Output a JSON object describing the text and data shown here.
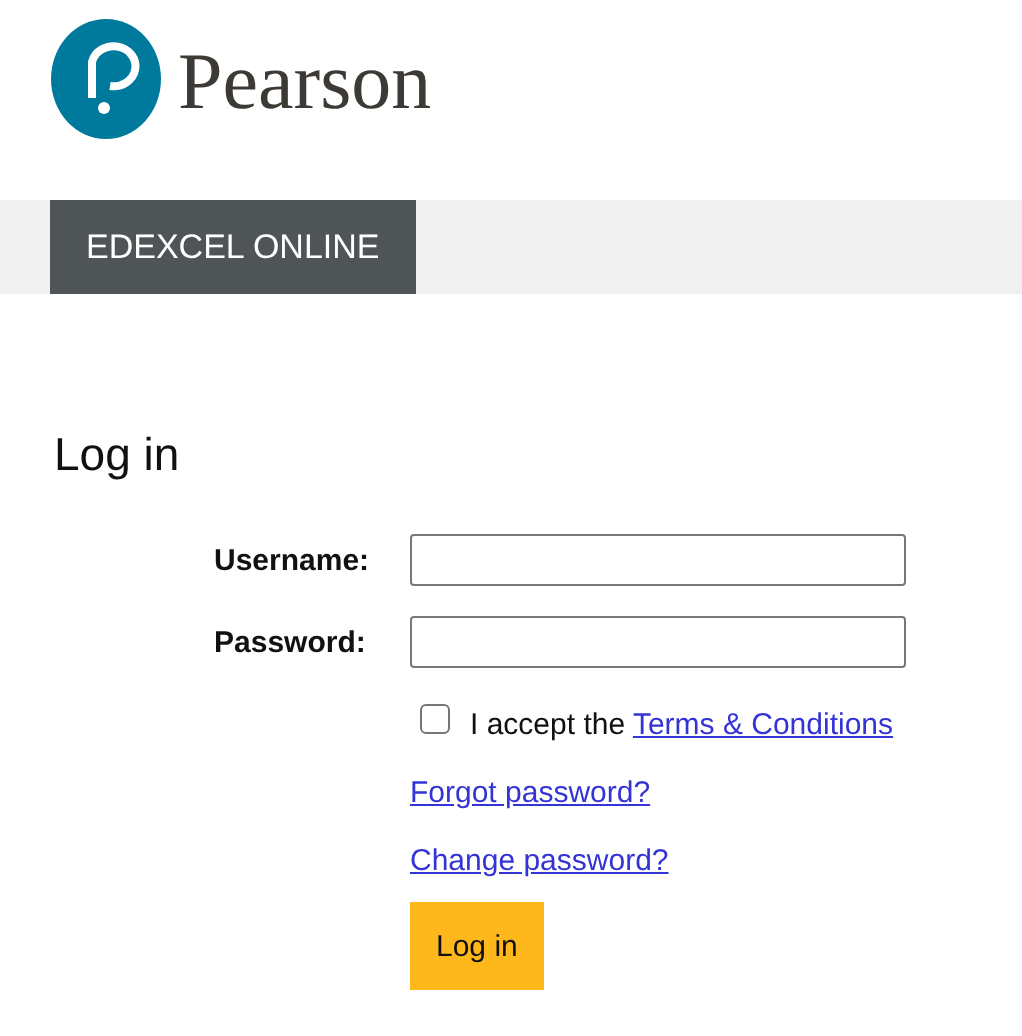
{
  "brand": {
    "name": "Pearson"
  },
  "nav": {
    "tabs": [
      {
        "label": "EDEXCEL ONLINE",
        "selected": true
      }
    ]
  },
  "heading": "Log in",
  "form": {
    "fields": [
      {
        "label": "Username:"
      },
      {
        "label": "Password:"
      }
    ],
    "terms": {
      "checked": false,
      "text": "I accept the ",
      "link": "Terms & Conditions"
    },
    "links": [
      "Forgot password?",
      "Change password?"
    ],
    "submit": "Log in"
  }
}
